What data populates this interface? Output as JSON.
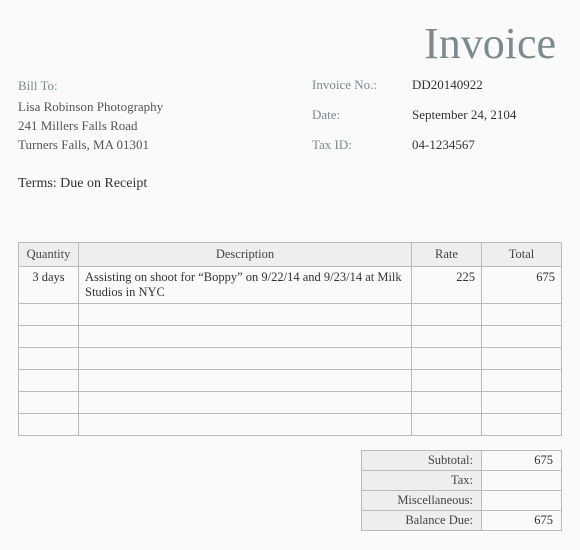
{
  "title": "Invoice",
  "bill_to": {
    "label": "Bill To:",
    "name": "Lisa Robinson Photography",
    "street": "241 Millers Falls Road",
    "city_state_zip": "Turners Falls, MA  01301"
  },
  "terms": "Terms:  Due on Receipt",
  "meta": {
    "invoice_no_label": "Invoice No.:",
    "invoice_no": "DD20140922",
    "date_label": "Date:",
    "date": "September 24, 2104",
    "tax_id_label": "Tax ID:",
    "tax_id": "04-1234567"
  },
  "columns": {
    "qty": "Quantity",
    "desc": "Description",
    "rate": "Rate",
    "total": "Total"
  },
  "rows": [
    {
      "qty": "3 days",
      "desc": "Assisting on shoot for “Boppy” on 9/22/14 and 9/23/14 at Milk Studios in NYC",
      "rate": "225",
      "total": "675"
    },
    {
      "qty": "",
      "desc": "",
      "rate": "",
      "total": ""
    },
    {
      "qty": "",
      "desc": "",
      "rate": "",
      "total": ""
    },
    {
      "qty": "",
      "desc": "",
      "rate": "",
      "total": ""
    },
    {
      "qty": "",
      "desc": "",
      "rate": "",
      "total": ""
    },
    {
      "qty": "",
      "desc": "",
      "rate": "",
      "total": ""
    },
    {
      "qty": "",
      "desc": "",
      "rate": "",
      "total": ""
    }
  ],
  "totals": {
    "subtotal_label": "Subtotal:",
    "subtotal": "675",
    "tax_label": "Tax:",
    "tax": "",
    "misc_label": "Miscellaneous:",
    "misc": "",
    "balance_label": "Balance Due:",
    "balance": "675"
  }
}
